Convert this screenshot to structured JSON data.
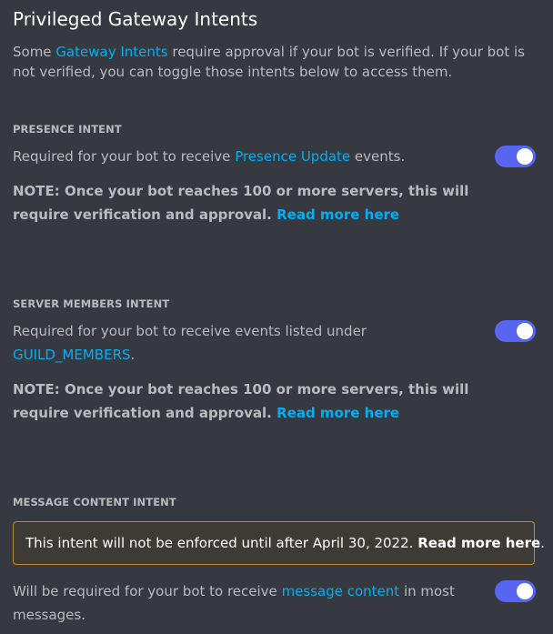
{
  "title": "Privileged Gateway Intents",
  "intro": {
    "prefix": "Some ",
    "link": "Gateway Intents",
    "suffix": " require approval if your bot is verified. If your bot is not verified, you can toggle those intents below to access them."
  },
  "intents": [
    {
      "heading": "PRESENCE INTENT",
      "desc_prefix": "Required for your bot to receive ",
      "desc_link": "Presence Update",
      "desc_suffix": " events.",
      "note": "NOTE: Once your bot reaches 100 or more servers, this will require verification and approval.",
      "note_link": "Read more here",
      "enabled": true
    },
    {
      "heading": "SERVER MEMBERS INTENT",
      "desc_prefix": "Required for your bot to receive events listed under",
      "desc_link": "GUILD_MEMBERS",
      "desc_suffix": ".",
      "note": "NOTE: Once your bot reaches 100 or more servers, this will require verification and approval.",
      "note_link": "Read more here",
      "enabled": true
    },
    {
      "heading": "MESSAGE CONTENT INTENT",
      "warning_text": "This intent will not be enforced until after April 30, 2022.",
      "warning_link": "Read more here",
      "warning_end": ".",
      "desc_prefix": "Will be required for your bot to receive ",
      "desc_link": "message content",
      "desc_suffix": " in most messages.",
      "enabled": true
    }
  ],
  "colors": {
    "background": "#36393f",
    "link": "#00aff4",
    "toggle_on": "#5865f2",
    "warning_border": "#c08a24"
  }
}
